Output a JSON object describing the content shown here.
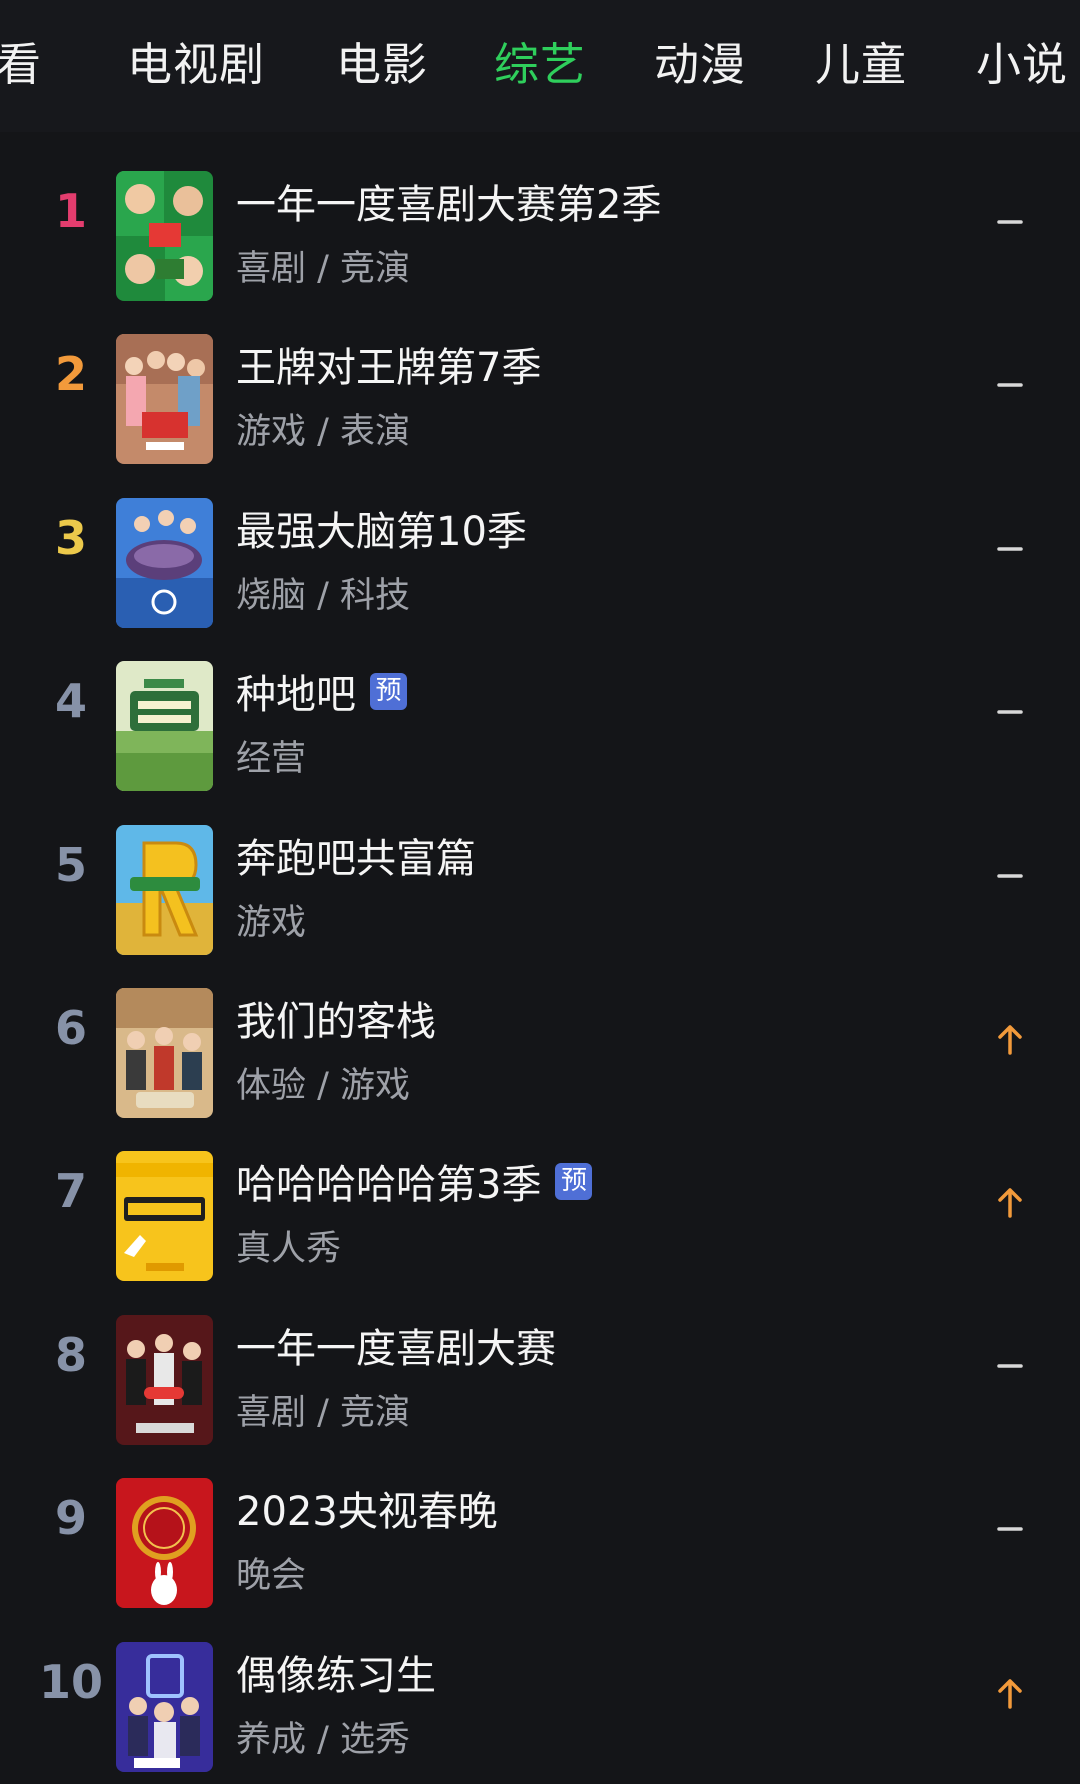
{
  "tabs": [
    {
      "label": "看",
      "active": false
    },
    {
      "label": "电视剧",
      "active": false
    },
    {
      "label": "电影",
      "active": false
    },
    {
      "label": "综艺",
      "active": true
    },
    {
      "label": "动漫",
      "active": false
    },
    {
      "label": "儿童",
      "active": false
    },
    {
      "label": "小说",
      "active": false
    }
  ],
  "colors": {
    "background": "#141518",
    "active_tab": "#2fcf5c",
    "rank_1": "#e33d6e",
    "rank_2": "#f29a3b",
    "rank_3": "#ecc94b",
    "rank_other": "#8792a8",
    "badge": "#4f6fd6",
    "trend_up": "#f29a3b",
    "trend_flat": "#d8d8d8"
  },
  "ranking": [
    {
      "rank": "1",
      "title": "一年一度喜剧大赛第2季",
      "tags": "喜剧 / 竞演",
      "badge": "",
      "trend": "flat",
      "poster": "poster-comedy-s2"
    },
    {
      "rank": "2",
      "title": "王牌对王牌第7季",
      "tags": "游戏 / 表演",
      "badge": "",
      "trend": "flat",
      "poster": "poster-ace-vs-ace"
    },
    {
      "rank": "3",
      "title": "最强大脑第10季",
      "tags": "烧脑 / 科技",
      "badge": "",
      "trend": "flat",
      "poster": "poster-super-brain"
    },
    {
      "rank": "4",
      "title": "种地吧",
      "tags": "经营",
      "badge": "预",
      "trend": "flat",
      "poster": "poster-farming"
    },
    {
      "rank": "5",
      "title": "奔跑吧共富篇",
      "tags": "游戏",
      "badge": "",
      "trend": "flat",
      "poster": "poster-keep-running"
    },
    {
      "rank": "6",
      "title": "我们的客栈",
      "tags": "体验 / 游戏",
      "badge": "",
      "trend": "up",
      "poster": "poster-our-inn"
    },
    {
      "rank": "7",
      "title": "哈哈哈哈哈第3季",
      "tags": "真人秀",
      "badge": "预",
      "trend": "up",
      "poster": "poster-hahaha"
    },
    {
      "rank": "8",
      "title": "一年一度喜剧大赛",
      "tags": "喜剧 / 竞演",
      "badge": "",
      "trend": "flat",
      "poster": "poster-comedy-s1"
    },
    {
      "rank": "9",
      "title": "2023央视春晚",
      "tags": "晚会",
      "badge": "",
      "trend": "flat",
      "poster": "poster-spring-gala"
    },
    {
      "rank": "10",
      "title": "偶像练习生",
      "tags": "养成 / 选秀",
      "badge": "",
      "trend": "up",
      "poster": "poster-idol-producer"
    }
  ]
}
